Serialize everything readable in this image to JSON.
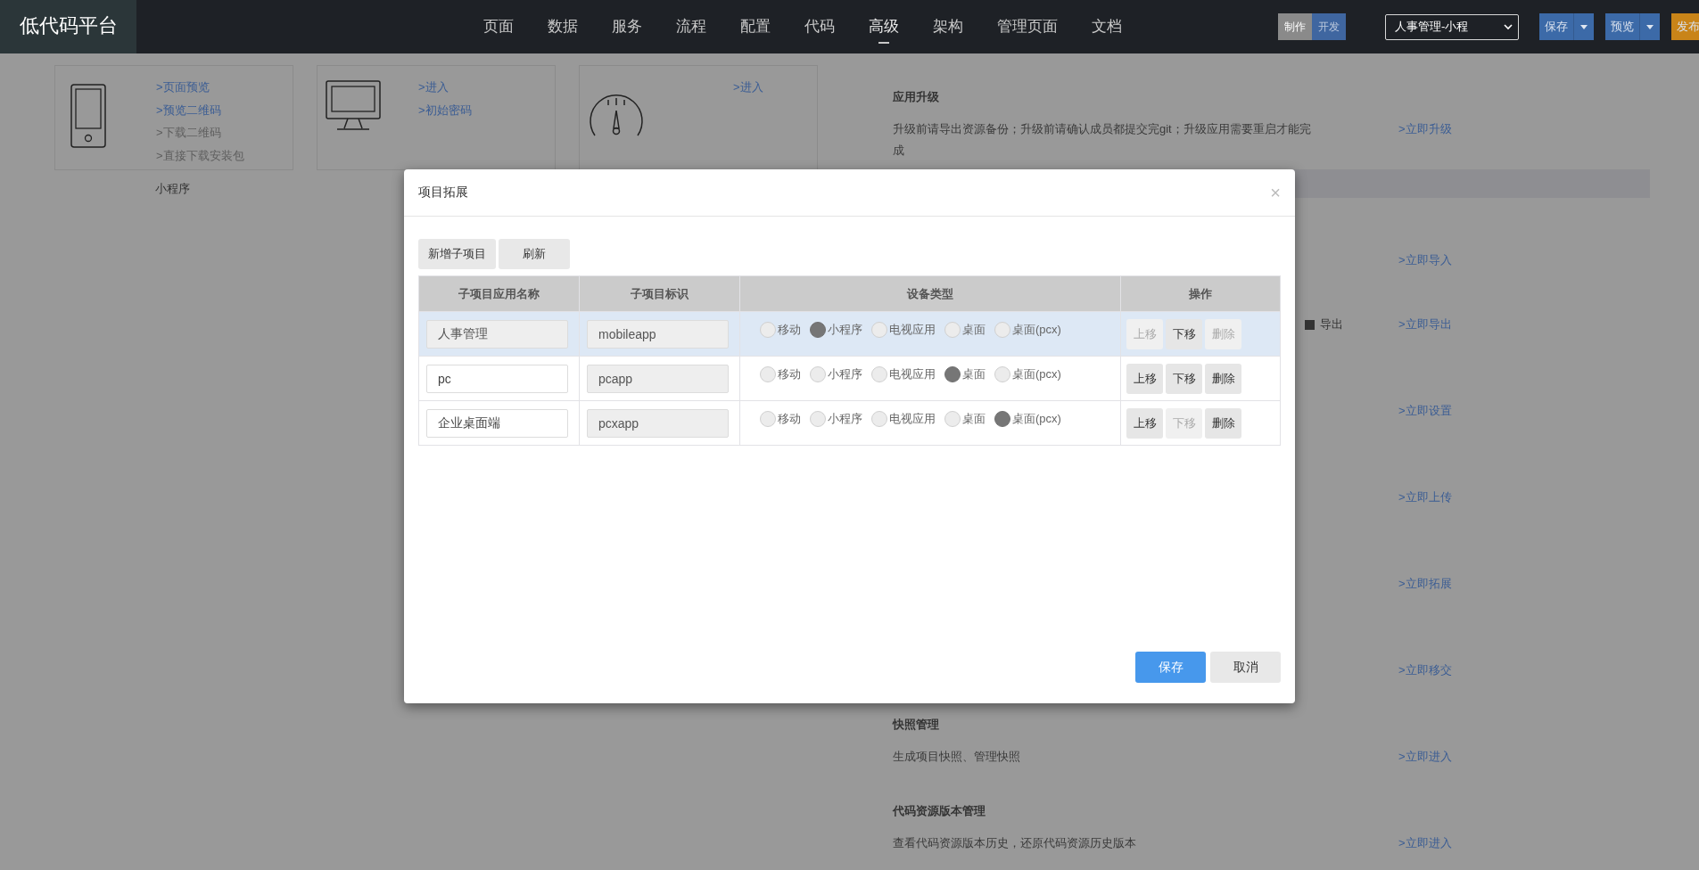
{
  "top_bar": {
    "logo": "低代码平台",
    "nav": [
      {
        "label": "页面",
        "selected": false
      },
      {
        "label": "数据",
        "selected": false
      },
      {
        "label": "服务",
        "selected": false
      },
      {
        "label": "流程",
        "selected": false
      },
      {
        "label": "配置",
        "selected": false
      },
      {
        "label": "代码",
        "selected": false
      },
      {
        "label": "高级",
        "selected": true
      },
      {
        "label": "架构",
        "selected": false
      },
      {
        "label": "管理页面",
        "selected": false
      },
      {
        "label": "文档",
        "selected": false
      }
    ],
    "mode_toggle": [
      {
        "label": "制作",
        "selected": false
      },
      {
        "label": "开发",
        "selected": true
      }
    ],
    "app_select": {
      "value": "人事管理-小程"
    },
    "buttons": [
      {
        "label": "保存",
        "kind": "primary"
      },
      {
        "label": "预览",
        "kind": "primary"
      },
      {
        "label": "发布",
        "kind": "warning"
      }
    ]
  },
  "cards": [
    {
      "links": [
        {
          "label": ">页面预览",
          "disabled": false
        },
        {
          "label": ">预览二维码",
          "disabled": false
        },
        {
          "label": ">下载二维码",
          "disabled": true
        },
        {
          "label": ">直接下载安装包",
          "disabled": true
        }
      ],
      "caption": "小程序"
    },
    {
      "links": [
        {
          "label": ">进入",
          "disabled": false
        },
        {
          "label": ">初始密码",
          "disabled": false
        }
      ]
    },
    {
      "links": [
        {
          "label": ">进入",
          "disabled": false
        }
      ]
    }
  ],
  "right_panel": {
    "upgrade": {
      "title": "应用升级",
      "description": "升级前请导出资源备份；升级前请确认成员都提交完git；升级应用需要重启才能完成",
      "link": ">立即升级"
    },
    "sections": [
      {
        "link": ">立即导入"
      },
      {
        "option": {
          "label": "导出",
          "checked": true
        },
        "link": ">立即导出"
      },
      {
        "link": ">立即设置"
      },
      {
        "link": ">立即上传"
      },
      {
        "link": ">立即拓展"
      },
      {
        "link": ">立即移交"
      },
      {
        "title": "快照管理",
        "description": "生成项目快照、管理快照",
        "link": ">立即进入"
      },
      {
        "title": "代码资源版本管理",
        "description": "查看代码资源版本历史，还原代码资源历史版本",
        "link": ">立即进入"
      }
    ]
  },
  "modal": {
    "title": "项目拓展",
    "close": "×",
    "toolbar": [
      "新增子项目",
      "刷新"
    ],
    "columns": [
      "子项目应用名称",
      "子项目标识",
      "设备类型",
      "操作"
    ],
    "rows": [
      {
        "selected": true,
        "name": {
          "value": "人事管理",
          "disabled": true
        },
        "identifier": "mobileapp",
        "device_types": [
          {
            "label": "移动",
            "selected": false
          },
          {
            "label": "小程序",
            "selected": true
          },
          {
            "label": "电视应用",
            "selected": false
          },
          {
            "label": "桌面",
            "selected": false
          },
          {
            "label": "桌面(pcx)",
            "selected": false
          }
        ],
        "actions": [
          {
            "label": "上移",
            "disabled": true
          },
          {
            "label": "下移",
            "disabled": false
          },
          {
            "label": "删除",
            "disabled": true
          }
        ]
      },
      {
        "selected": false,
        "name": {
          "value": "pc",
          "disabled": false
        },
        "identifier": "pcapp",
        "device_types": [
          {
            "label": "移动",
            "selected": false
          },
          {
            "label": "小程序",
            "selected": false
          },
          {
            "label": "电视应用",
            "selected": false
          },
          {
            "label": "桌面",
            "selected": true
          },
          {
            "label": "桌面(pcx)",
            "selected": false
          }
        ],
        "actions": [
          {
            "label": "上移",
            "disabled": false
          },
          {
            "label": "下移",
            "disabled": false
          },
          {
            "label": "删除",
            "disabled": false
          }
        ]
      },
      {
        "selected": false,
        "name": {
          "value": "企业桌面端",
          "disabled": false
        },
        "identifier": "pcxapp",
        "device_types": [
          {
            "label": "移动",
            "selected": false
          },
          {
            "label": "小程序",
            "selected": false
          },
          {
            "label": "电视应用",
            "selected": false
          },
          {
            "label": "桌面",
            "selected": false
          },
          {
            "label": "桌面(pcx)",
            "selected": true
          }
        ],
        "actions": [
          {
            "label": "上移",
            "disabled": false
          },
          {
            "label": "下移",
            "disabled": true
          },
          {
            "label": "删除",
            "disabled": false
          }
        ]
      }
    ],
    "footer": [
      {
        "label": "保存",
        "kind": "primary"
      },
      {
        "label": "取消",
        "kind": "default"
      }
    ]
  }
}
